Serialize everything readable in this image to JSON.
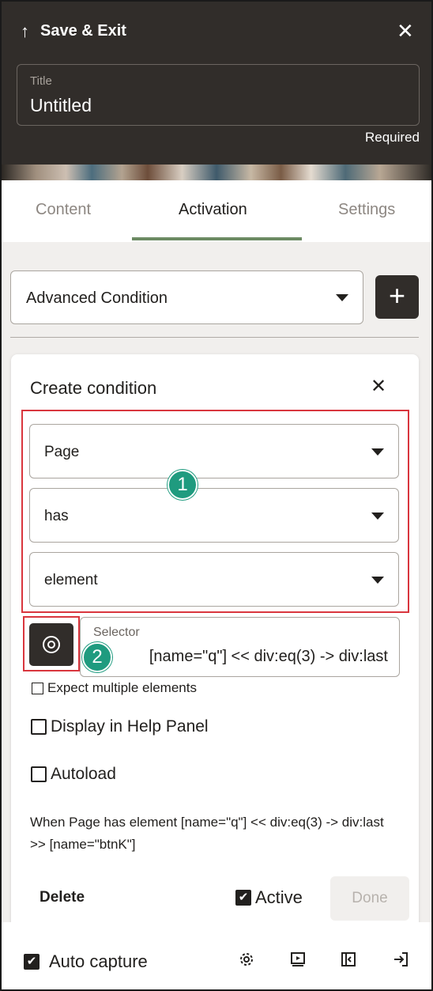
{
  "header": {
    "save_exit_label": "Save & Exit",
    "title_field": {
      "label": "Title",
      "value": "Untitled"
    },
    "required_label": "Required"
  },
  "tabs": [
    {
      "label": "Content",
      "active": false
    },
    {
      "label": "Activation",
      "active": true
    },
    {
      "label": "Settings",
      "active": false
    }
  ],
  "activation": {
    "condition_type": "Advanced Condition",
    "create_condition": {
      "title": "Create condition",
      "selects": [
        "Page",
        "has",
        "element"
      ],
      "selector_label": "Selector",
      "selector_value": "[name=\"q\"] << div:eq(3) -> div:last",
      "expect_multiple_label": "Expect multiple elements",
      "display_help_panel_label": "Display in Help Panel",
      "autoload_label": "Autoload",
      "summary": "When Page has element [name=\"q\"] << div:eq(3) -> div:last >> [name=\"btnK\"]",
      "delete_label": "Delete",
      "active_label": "Active",
      "done_label": "Done"
    }
  },
  "annotations": {
    "badge_1": "1",
    "badge_2": "2"
  },
  "footer": {
    "auto_capture_label": "Auto capture"
  },
  "colors": {
    "header_bg": "#312d2a",
    "accent_green": "#6c8a63",
    "badge_teal": "#1f9b7f",
    "highlight_red": "#d9363e"
  }
}
